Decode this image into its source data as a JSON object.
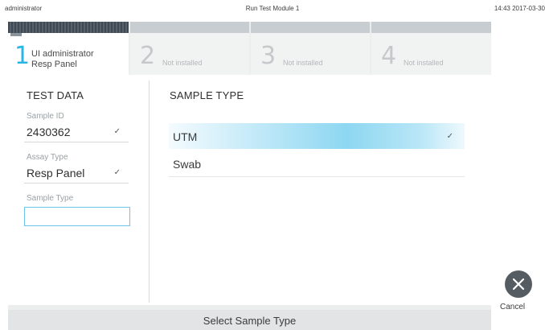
{
  "statusbar": {
    "user": "administrator",
    "title": "Run Test Module 1",
    "clock": "14:43 2017-03-30"
  },
  "tabs": [
    {
      "number": "1",
      "line1": "UI administrator",
      "line2": "Resp Panel",
      "active": true
    },
    {
      "number": "2",
      "line1": "Not installed",
      "line2": "",
      "active": false
    },
    {
      "number": "3",
      "line1": "Not installed",
      "line2": "",
      "active": false
    },
    {
      "number": "4",
      "line1": "Not installed",
      "line2": "",
      "active": false
    }
  ],
  "test_data": {
    "title": "TEST DATA",
    "sample_id_label": "Sample ID",
    "sample_id_value": "2430362",
    "assay_type_label": "Assay Type",
    "assay_type_value": "Resp Panel",
    "sample_type_label": "Sample Type",
    "sample_type_value": ""
  },
  "sample_type": {
    "title": "SAMPLE TYPE",
    "options": [
      {
        "label": "UTM",
        "selected": true
      },
      {
        "label": "Swab",
        "selected": false
      }
    ]
  },
  "check_glyph": "✓",
  "bottom": {
    "message": "Select Sample Type"
  },
  "cancel": {
    "label": "Cancel"
  },
  "colors": {
    "accent": "#29b6e6",
    "selected_option": "#8dd7f1",
    "frame": "#eceded",
    "cancel_button": "#555d63"
  },
  "icons": {
    "cancel": "close-icon",
    "check": "checkmark-icon"
  }
}
